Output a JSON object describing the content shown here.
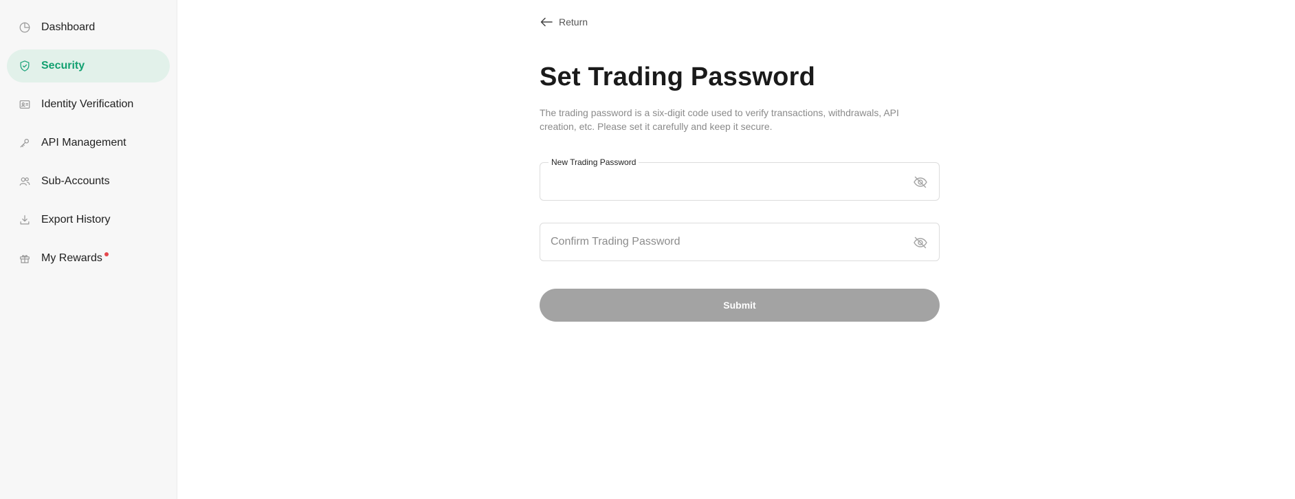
{
  "sidebar": {
    "items": [
      {
        "label": "Dashboard",
        "icon": "dashboard-icon",
        "active": false
      },
      {
        "label": "Security",
        "icon": "shield-icon",
        "active": true
      },
      {
        "label": "Identity Verification",
        "icon": "id-card-icon",
        "active": false
      },
      {
        "label": "API Management",
        "icon": "api-key-icon",
        "active": false
      },
      {
        "label": "Sub-Accounts",
        "icon": "users-icon",
        "active": false
      },
      {
        "label": "Export History",
        "icon": "download-icon",
        "active": false
      },
      {
        "label": "My Rewards",
        "icon": "gift-icon",
        "active": false,
        "has_notification_dot": true
      }
    ]
  },
  "colors": {
    "accent": "#12a070",
    "active_bg": "#e2f1ea",
    "notification_dot": "#e5484d",
    "submit_disabled": "#a3a3a3"
  },
  "main": {
    "return_label": "Return",
    "title": "Set Trading Password",
    "description": "The trading password is a six-digit code used to verify transactions, withdrawals, API creation, etc. Please set it carefully and keep it secure.",
    "new_password": {
      "label": "New Trading Password",
      "value": ""
    },
    "confirm_password": {
      "placeholder": "Confirm Trading Password",
      "value": ""
    },
    "submit_label": "Submit"
  }
}
